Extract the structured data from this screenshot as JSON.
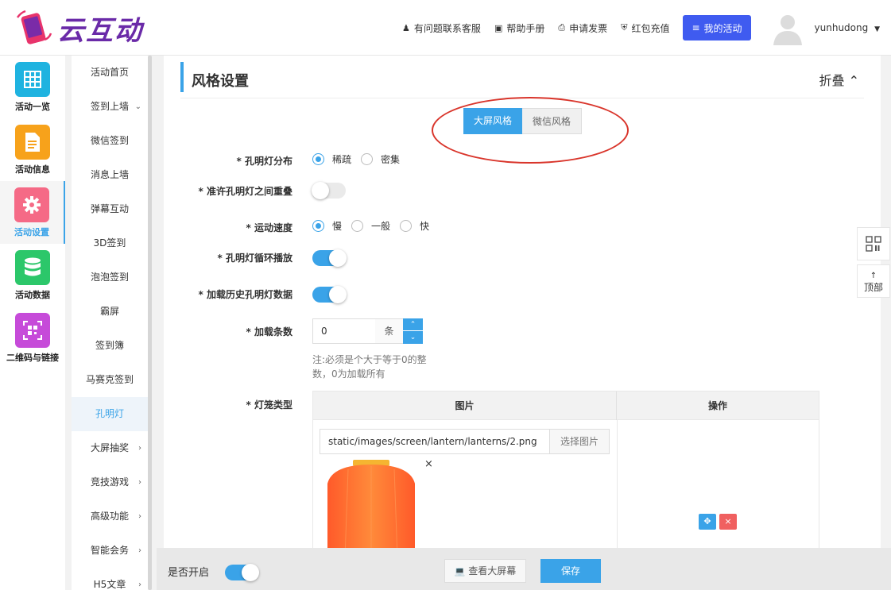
{
  "header": {
    "logo_text": "云互动",
    "links": [
      {
        "label": "有问题联系客服",
        "icon": "user-plus-icon"
      },
      {
        "label": "帮助手册",
        "icon": "book-icon"
      },
      {
        "label": "申请发票",
        "icon": "printer-icon"
      },
      {
        "label": "红包充值",
        "icon": "shield-check-icon"
      }
    ],
    "my_activity": "我的活动",
    "username": "yunhudong"
  },
  "sidebar1": [
    {
      "label": "活动一览",
      "color": "#1fb3e0",
      "icon": "grid-icon"
    },
    {
      "label": "活动信息",
      "color": "#f7a21b",
      "icon": "document-icon"
    },
    {
      "label": "活动设置",
      "color": "#f56a86",
      "icon": "gear-icon",
      "active": true
    },
    {
      "label": "活动数据",
      "color": "#2cc76a",
      "icon": "database-icon"
    },
    {
      "label": "二维码与链接",
      "color": "#c64bd9",
      "icon": "qrcode-icon"
    }
  ],
  "sidebar2": [
    {
      "label": "活动首页",
      "arrow": ""
    },
    {
      "label": "签到上墙",
      "arrow": "⌄"
    },
    {
      "label": "微信签到",
      "arrow": ""
    },
    {
      "label": "消息上墙",
      "arrow": ""
    },
    {
      "label": "弹幕互动",
      "arrow": ""
    },
    {
      "label": "3D签到",
      "arrow": ""
    },
    {
      "label": "泡泡签到",
      "arrow": ""
    },
    {
      "label": "霸屏",
      "arrow": ""
    },
    {
      "label": "签到簿",
      "arrow": ""
    },
    {
      "label": "马赛克签到",
      "arrow": ""
    },
    {
      "label": "孔明灯",
      "arrow": "",
      "active": true
    },
    {
      "label": "大屏抽奖",
      "arrow": "›"
    },
    {
      "label": "竞技游戏",
      "arrow": "›"
    },
    {
      "label": "高级功能",
      "arrow": "›"
    },
    {
      "label": "智能会务",
      "arrow": "›"
    },
    {
      "label": "H5文章",
      "arrow": "›"
    }
  ],
  "panel": {
    "title": "风格设置",
    "fold": "折叠 ⌃"
  },
  "style_tabs": {
    "big": "大屏风格",
    "wechat": "微信风格"
  },
  "form": {
    "distribution_label": "* 孔明灯分布",
    "distribution_options": [
      "稀疏",
      "密集"
    ],
    "distribution_selected": 0,
    "overlap_label": "* 准许孔明灯之间重叠",
    "overlap_on": false,
    "speed_label": "* 运动速度",
    "speed_options": [
      "慢",
      "一般",
      "快"
    ],
    "speed_selected": 0,
    "loop_label": "* 孔明灯循环播放",
    "loop_on": true,
    "history_label": "* 加载历史孔明灯数据",
    "history_on": true,
    "count_label": "* 加载条数",
    "count_value": "0",
    "count_unit": "条",
    "count_hint": "注:必须是个大于等于0的整数，0为加载所有",
    "lantern_label": "* 灯笼类型",
    "table_col_image": "图片",
    "table_col_action": "操作",
    "lantern_path": "static/images/screen/lantern/lanterns/2.png",
    "choose_image": "选择图片"
  },
  "footer": {
    "enable_label": "是否开启",
    "enable_on": true,
    "view_screen": "查看大屏幕",
    "save": "保存"
  },
  "float": {
    "top_label": "顶部"
  }
}
